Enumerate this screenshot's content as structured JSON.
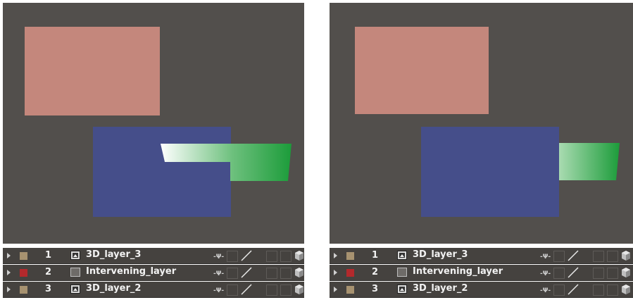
{
  "colors": {
    "comp_background": "#524f4c",
    "pink_layer": "#c4877c",
    "blue_layer": "#454e8a",
    "green_layer": "#1c9c3a",
    "swatch_tan": "#a79270",
    "swatch_red": "#b3292c",
    "timeline_row": "#45423f"
  },
  "panels": [
    {
      "id": "before",
      "layers": [
        {
          "number": "1",
          "name": "3D_layer_3",
          "icon": "footage-icon",
          "swatch": "tan"
        },
        {
          "number": "2",
          "name": "Intervening_layer",
          "icon": "solid-icon",
          "swatch": "red"
        },
        {
          "number": "3",
          "name": "3D_layer_2",
          "icon": "footage-icon",
          "swatch": "tan"
        }
      ]
    },
    {
      "id": "after",
      "layers": [
        {
          "number": "1",
          "name": "3D_layer_3",
          "icon": "footage-icon",
          "swatch": "tan"
        },
        {
          "number": "2",
          "name": "Intervening_layer",
          "icon": "solid-icon",
          "swatch": "red"
        },
        {
          "number": "3",
          "name": "3D_layer_2",
          "icon": "footage-icon",
          "swatch": "tan"
        }
      ]
    }
  ]
}
